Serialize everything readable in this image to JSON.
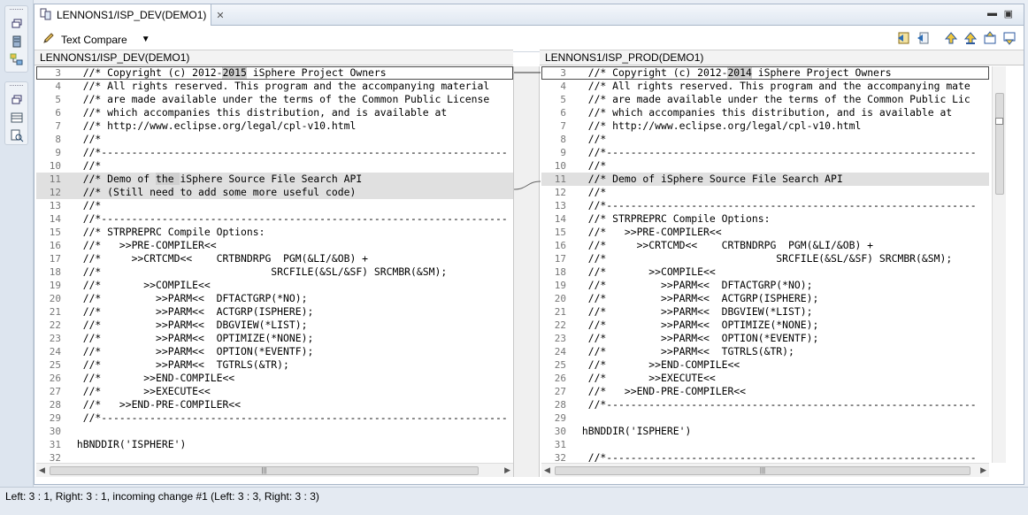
{
  "editor": {
    "tab_title": "LENNONS1/ISP_DEV(DEMO1)",
    "toolbar_label": "Text Compare"
  },
  "left": {
    "header": "LENNONS1/ISP_DEV(DEMO1)",
    "lines": [
      {
        "n": "3",
        "t": "  //* Copyright (c) 2012-2015 iSphere Project Owners",
        "hl": "2015",
        "first": true
      },
      {
        "n": "4",
        "t": "  //* All rights reserved. This program and the accompanying material"
      },
      {
        "n": "5",
        "t": "  //* are made available under the terms of the Common Public License"
      },
      {
        "n": "6",
        "t": "  //* which accompanies this distribution, and is available at"
      },
      {
        "n": "7",
        "t": "  //* http://www.eclipse.org/legal/cpl-v10.html"
      },
      {
        "n": "8",
        "t": "  //*"
      },
      {
        "n": "9",
        "t": "  //*-------------------------------------------------------------------"
      },
      {
        "n": "10",
        "t": "  //*"
      },
      {
        "n": "11",
        "t": "  //* Demo of the iSphere Source File Search API",
        "chg": true,
        "hl": "the "
      },
      {
        "n": "12",
        "t": "  //* (Still need to add some more useful code)",
        "chg": true
      },
      {
        "n": "13",
        "t": "  //*"
      },
      {
        "n": "14",
        "t": "  //*-------------------------------------------------------------------"
      },
      {
        "n": "15",
        "t": "  //* STRPREPRC Compile Options:"
      },
      {
        "n": "16",
        "t": "  //*   >>PRE-COMPILER<<"
      },
      {
        "n": "17",
        "t": "  //*     >>CRTCMD<<    CRTBNDRPG  PGM(&LI/&OB) +"
      },
      {
        "n": "18",
        "t": "  //*                            SRCFILE(&SL/&SF) SRCMBR(&SM);"
      },
      {
        "n": "19",
        "t": "  //*       >>COMPILE<<"
      },
      {
        "n": "20",
        "t": "  //*         >>PARM<<  DFTACTGRP(*NO);"
      },
      {
        "n": "21",
        "t": "  //*         >>PARM<<  ACTGRP(ISPHERE);"
      },
      {
        "n": "22",
        "t": "  //*         >>PARM<<  DBGVIEW(*LIST);"
      },
      {
        "n": "23",
        "t": "  //*         >>PARM<<  OPTIMIZE(*NONE);"
      },
      {
        "n": "24",
        "t": "  //*         >>PARM<<  OPTION(*EVENTF);"
      },
      {
        "n": "25",
        "t": "  //*         >>PARM<<  TGTRLS(&TR);"
      },
      {
        "n": "26",
        "t": "  //*       >>END-COMPILE<<"
      },
      {
        "n": "27",
        "t": "  //*       >>EXECUTE<<"
      },
      {
        "n": "28",
        "t": "  //*   >>END-PRE-COMPILER<<"
      },
      {
        "n": "29",
        "t": "  //*-------------------------------------------------------------------"
      },
      {
        "n": "30",
        "t": ""
      },
      {
        "n": "31",
        "t": " hBNDDIR('ISPHERE')"
      },
      {
        "n": "32",
        "t": ""
      }
    ]
  },
  "right": {
    "header": "LENNONS1/ISP_PROD(DEMO1)",
    "lines": [
      {
        "n": "3",
        "t": "  //* Copyright (c) 2012-2014 iSphere Project Owners",
        "hl": "2014",
        "first": true
      },
      {
        "n": "4",
        "t": "  //* All rights reserved. This program and the accompanying mate"
      },
      {
        "n": "5",
        "t": "  //* are made available under the terms of the Common Public Lic"
      },
      {
        "n": "6",
        "t": "  //* which accompanies this distribution, and is available at"
      },
      {
        "n": "7",
        "t": "  //* http://www.eclipse.org/legal/cpl-v10.html"
      },
      {
        "n": "8",
        "t": "  //*"
      },
      {
        "n": "9",
        "t": "  //*-------------------------------------------------------------"
      },
      {
        "n": "10",
        "t": "  //*"
      },
      {
        "n": "11",
        "t": "  //* Demo of iSphere Source File Search API",
        "chg": true
      },
      {
        "n": "12",
        "t": "  //*"
      },
      {
        "n": "13",
        "t": "  //*-------------------------------------------------------------"
      },
      {
        "n": "14",
        "t": "  //* STRPREPRC Compile Options:"
      },
      {
        "n": "15",
        "t": "  //*   >>PRE-COMPILER<<"
      },
      {
        "n": "16",
        "t": "  //*     >>CRTCMD<<    CRTBNDRPG  PGM(&LI/&OB) +"
      },
      {
        "n": "17",
        "t": "  //*                            SRCFILE(&SL/&SF) SRCMBR(&SM);"
      },
      {
        "n": "18",
        "t": "  //*       >>COMPILE<<"
      },
      {
        "n": "19",
        "t": "  //*         >>PARM<<  DFTACTGRP(*NO);"
      },
      {
        "n": "20",
        "t": "  //*         >>PARM<<  ACTGRP(ISPHERE);"
      },
      {
        "n": "21",
        "t": "  //*         >>PARM<<  DBGVIEW(*LIST);"
      },
      {
        "n": "22",
        "t": "  //*         >>PARM<<  OPTIMIZE(*NONE);"
      },
      {
        "n": "23",
        "t": "  //*         >>PARM<<  OPTION(*EVENTF);"
      },
      {
        "n": "24",
        "t": "  //*         >>PARM<<  TGTRLS(&TR);"
      },
      {
        "n": "25",
        "t": "  //*       >>END-COMPILE<<"
      },
      {
        "n": "26",
        "t": "  //*       >>EXECUTE<<"
      },
      {
        "n": "27",
        "t": "  //*   >>END-PRE-COMPILER<<"
      },
      {
        "n": "28",
        "t": "  //*-------------------------------------------------------------"
      },
      {
        "n": "29",
        "t": ""
      },
      {
        "n": "30",
        "t": " hBNDDIR('ISPHERE')"
      },
      {
        "n": "31",
        "t": ""
      },
      {
        "n": "32",
        "t": "  //*-------------------------------------------------------------"
      }
    ]
  },
  "status": {
    "text": "Left: 3 : 1, Right: 3 : 1, incoming change #1 (Left: 3 : 3, Right: 3 : 3)"
  }
}
